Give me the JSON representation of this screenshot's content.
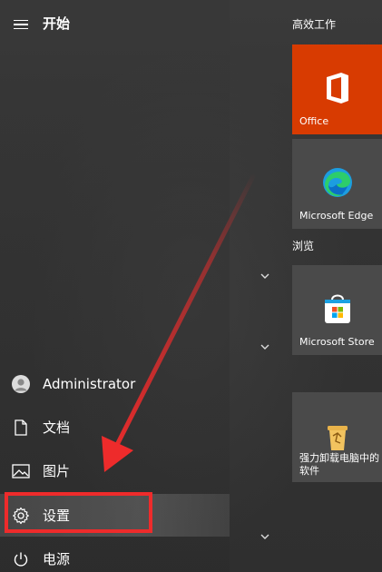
{
  "start": {
    "title": "开始",
    "menu": [
      {
        "label": "Administrator",
        "icon": "user-avatar-icon"
      },
      {
        "label": "文档",
        "icon": "document-icon"
      },
      {
        "label": "图片",
        "icon": "picture-icon"
      },
      {
        "label": "设置",
        "icon": "gear-icon",
        "selected": true
      },
      {
        "label": "电源",
        "icon": "power-icon"
      }
    ]
  },
  "tiles": {
    "group_productivity": "高效工作",
    "group_browse": "浏览",
    "items": [
      {
        "label": "Office",
        "icon": "office-icon",
        "color": "#d83b01"
      },
      {
        "label": "Microsoft Edge",
        "icon": "edge-icon",
        "color": "#4a4a4a"
      },
      {
        "label": "Microsoft Store",
        "icon": "store-icon",
        "color": "#4a4a4a"
      },
      {
        "label": "强力卸载电脑中的软件",
        "icon": "recycle-bin-icon",
        "color": "#4a4a4a"
      }
    ]
  },
  "annotations": {
    "highlight_color": "#ee2b2b"
  }
}
